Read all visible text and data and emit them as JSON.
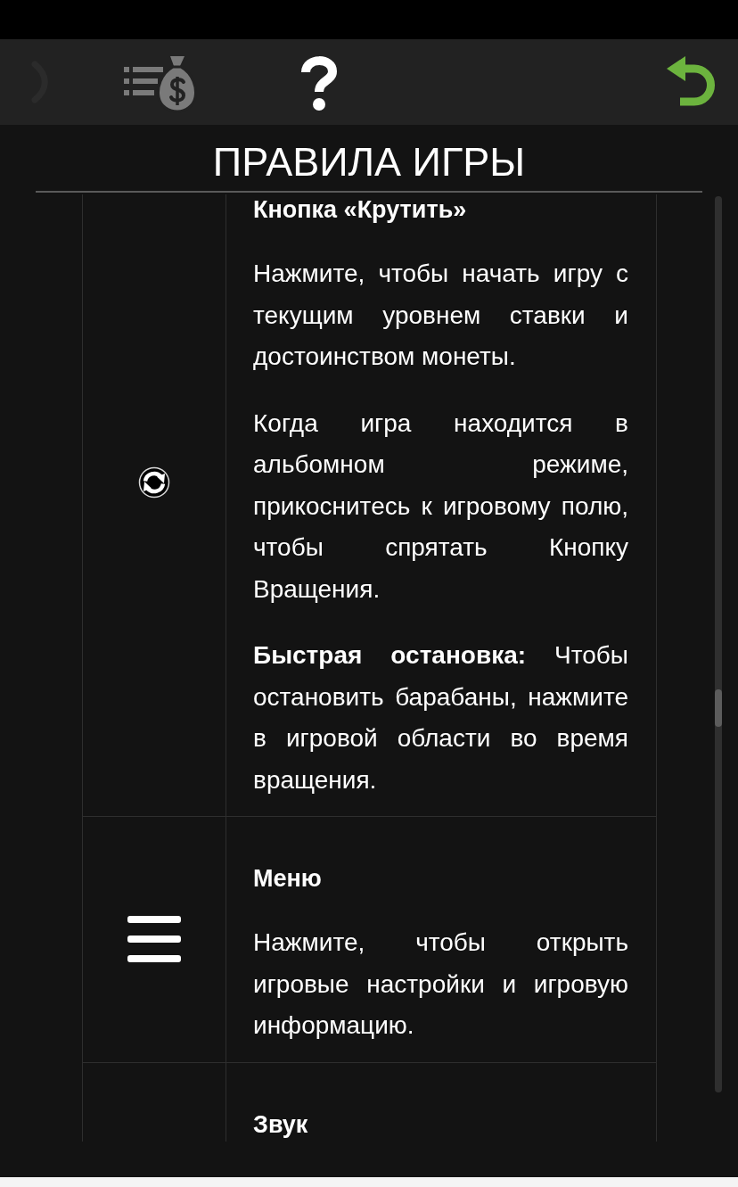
{
  "toolbar": {
    "items": [
      {
        "kind": "chevron",
        "disabled": true,
        "selected": false
      },
      {
        "kind": "paytable",
        "disabled": false,
        "selected": false
      },
      {
        "kind": "help",
        "disabled": false,
        "selected": true
      }
    ]
  },
  "title": "ПРАВИЛА ИГРЫ",
  "rules": {
    "rows": [
      {
        "kind": "spin",
        "title": "Кнопка «Крутить»",
        "paragraphs": [
          "Нажмите, чтобы начать игру с текущим уровнем ставки и достоинством монеты.",
          "Когда игра находится в альбомном режиме, прикоснитесь к игровому полю, чтобы спрятать Кнопку Вращения.",
          "**Быстрая остановка:** Чтобы остановить барабаны, нажмите в игровой области во время вращения."
        ]
      },
      {
        "kind": "menu",
        "title": "Меню",
        "paragraphs": [
          "Нажмите, чтобы открыть игровые настройки и игровую информацию."
        ]
      },
      {
        "title": "Звук"
      }
    ]
  }
}
